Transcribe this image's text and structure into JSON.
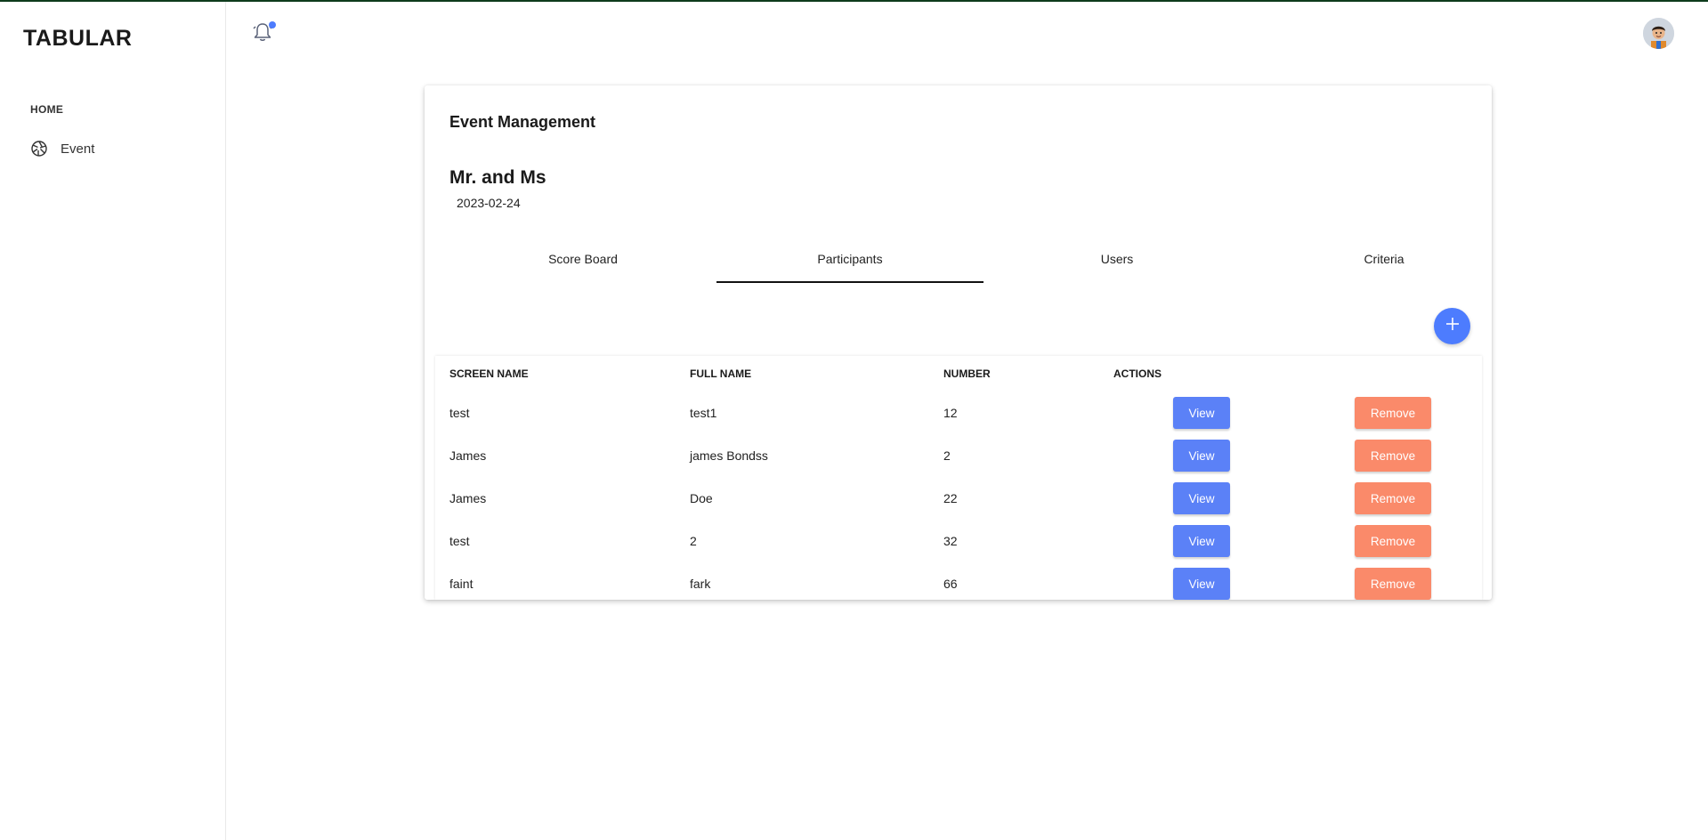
{
  "app": {
    "logo": "TABULAR"
  },
  "sidebar": {
    "section": "HOME",
    "items": [
      {
        "label": "Event",
        "icon": "aperture-icon"
      }
    ]
  },
  "header": {
    "notification_icon": "bell-icon",
    "has_notification": true,
    "avatar": "user-avatar"
  },
  "page": {
    "title": "Event Management",
    "event_name": "Mr. and Ms",
    "event_date": "2023-02-24"
  },
  "tabs": [
    {
      "label": "Score Board",
      "active": false
    },
    {
      "label": "Participants",
      "active": true
    },
    {
      "label": "Users",
      "active": false
    },
    {
      "label": "Criteria",
      "active": false
    }
  ],
  "add_button_icon": "plus-icon",
  "table": {
    "headers": {
      "screen_name": "SCREEN NAME",
      "full_name": "FULL NAME",
      "number": "NUMBER",
      "actions": "ACTIONS"
    },
    "rows": [
      {
        "screen_name": "test",
        "full_name": "test1",
        "number": "12",
        "view": "View",
        "remove": "Remove"
      },
      {
        "screen_name": "James",
        "full_name": "james Bondss",
        "number": "2",
        "view": "View",
        "remove": "Remove"
      },
      {
        "screen_name": "James",
        "full_name": "Doe",
        "number": "22",
        "view": "View",
        "remove": "Remove"
      },
      {
        "screen_name": "test",
        "full_name": "2",
        "number": "32",
        "view": "View",
        "remove": "Remove"
      },
      {
        "screen_name": "faint",
        "full_name": "fark",
        "number": "66",
        "view": "View",
        "remove": "Remove"
      }
    ]
  },
  "colors": {
    "accent": "#4d7cfe",
    "view_button": "#5b81f7",
    "remove_button": "#fa8a6a",
    "top_line": "#0e3b1c"
  }
}
